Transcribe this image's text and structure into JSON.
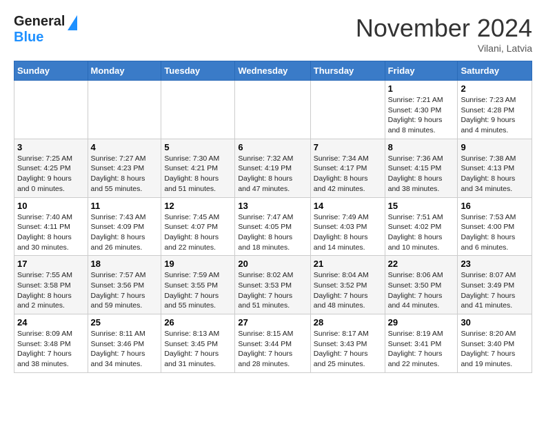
{
  "header": {
    "logo_general": "General",
    "logo_blue": "Blue",
    "month_title": "November 2024",
    "location": "Vilani, Latvia"
  },
  "days_of_week": [
    "Sunday",
    "Monday",
    "Tuesday",
    "Wednesday",
    "Thursday",
    "Friday",
    "Saturday"
  ],
  "weeks": [
    [
      {
        "day": "",
        "info": ""
      },
      {
        "day": "",
        "info": ""
      },
      {
        "day": "",
        "info": ""
      },
      {
        "day": "",
        "info": ""
      },
      {
        "day": "",
        "info": ""
      },
      {
        "day": "1",
        "info": "Sunrise: 7:21 AM\nSunset: 4:30 PM\nDaylight: 9 hours\nand 8 minutes."
      },
      {
        "day": "2",
        "info": "Sunrise: 7:23 AM\nSunset: 4:28 PM\nDaylight: 9 hours\nand 4 minutes."
      }
    ],
    [
      {
        "day": "3",
        "info": "Sunrise: 7:25 AM\nSunset: 4:25 PM\nDaylight: 9 hours\nand 0 minutes."
      },
      {
        "day": "4",
        "info": "Sunrise: 7:27 AM\nSunset: 4:23 PM\nDaylight: 8 hours\nand 55 minutes."
      },
      {
        "day": "5",
        "info": "Sunrise: 7:30 AM\nSunset: 4:21 PM\nDaylight: 8 hours\nand 51 minutes."
      },
      {
        "day": "6",
        "info": "Sunrise: 7:32 AM\nSunset: 4:19 PM\nDaylight: 8 hours\nand 47 minutes."
      },
      {
        "day": "7",
        "info": "Sunrise: 7:34 AM\nSunset: 4:17 PM\nDaylight: 8 hours\nand 42 minutes."
      },
      {
        "day": "8",
        "info": "Sunrise: 7:36 AM\nSunset: 4:15 PM\nDaylight: 8 hours\nand 38 minutes."
      },
      {
        "day": "9",
        "info": "Sunrise: 7:38 AM\nSunset: 4:13 PM\nDaylight: 8 hours\nand 34 minutes."
      }
    ],
    [
      {
        "day": "10",
        "info": "Sunrise: 7:40 AM\nSunset: 4:11 PM\nDaylight: 8 hours\nand 30 minutes."
      },
      {
        "day": "11",
        "info": "Sunrise: 7:43 AM\nSunset: 4:09 PM\nDaylight: 8 hours\nand 26 minutes."
      },
      {
        "day": "12",
        "info": "Sunrise: 7:45 AM\nSunset: 4:07 PM\nDaylight: 8 hours\nand 22 minutes."
      },
      {
        "day": "13",
        "info": "Sunrise: 7:47 AM\nSunset: 4:05 PM\nDaylight: 8 hours\nand 18 minutes."
      },
      {
        "day": "14",
        "info": "Sunrise: 7:49 AM\nSunset: 4:03 PM\nDaylight: 8 hours\nand 14 minutes."
      },
      {
        "day": "15",
        "info": "Sunrise: 7:51 AM\nSunset: 4:02 PM\nDaylight: 8 hours\nand 10 minutes."
      },
      {
        "day": "16",
        "info": "Sunrise: 7:53 AM\nSunset: 4:00 PM\nDaylight: 8 hours\nand 6 minutes."
      }
    ],
    [
      {
        "day": "17",
        "info": "Sunrise: 7:55 AM\nSunset: 3:58 PM\nDaylight: 8 hours\nand 2 minutes."
      },
      {
        "day": "18",
        "info": "Sunrise: 7:57 AM\nSunset: 3:56 PM\nDaylight: 7 hours\nand 59 minutes."
      },
      {
        "day": "19",
        "info": "Sunrise: 7:59 AM\nSunset: 3:55 PM\nDaylight: 7 hours\nand 55 minutes."
      },
      {
        "day": "20",
        "info": "Sunrise: 8:02 AM\nSunset: 3:53 PM\nDaylight: 7 hours\nand 51 minutes."
      },
      {
        "day": "21",
        "info": "Sunrise: 8:04 AM\nSunset: 3:52 PM\nDaylight: 7 hours\nand 48 minutes."
      },
      {
        "day": "22",
        "info": "Sunrise: 8:06 AM\nSunset: 3:50 PM\nDaylight: 7 hours\nand 44 minutes."
      },
      {
        "day": "23",
        "info": "Sunrise: 8:07 AM\nSunset: 3:49 PM\nDaylight: 7 hours\nand 41 minutes."
      }
    ],
    [
      {
        "day": "24",
        "info": "Sunrise: 8:09 AM\nSunset: 3:48 PM\nDaylight: 7 hours\nand 38 minutes."
      },
      {
        "day": "25",
        "info": "Sunrise: 8:11 AM\nSunset: 3:46 PM\nDaylight: 7 hours\nand 34 minutes."
      },
      {
        "day": "26",
        "info": "Sunrise: 8:13 AM\nSunset: 3:45 PM\nDaylight: 7 hours\nand 31 minutes."
      },
      {
        "day": "27",
        "info": "Sunrise: 8:15 AM\nSunset: 3:44 PM\nDaylight: 7 hours\nand 28 minutes."
      },
      {
        "day": "28",
        "info": "Sunrise: 8:17 AM\nSunset: 3:43 PM\nDaylight: 7 hours\nand 25 minutes."
      },
      {
        "day": "29",
        "info": "Sunrise: 8:19 AM\nSunset: 3:41 PM\nDaylight: 7 hours\nand 22 minutes."
      },
      {
        "day": "30",
        "info": "Sunrise: 8:20 AM\nSunset: 3:40 PM\nDaylight: 7 hours\nand 19 minutes."
      }
    ]
  ]
}
